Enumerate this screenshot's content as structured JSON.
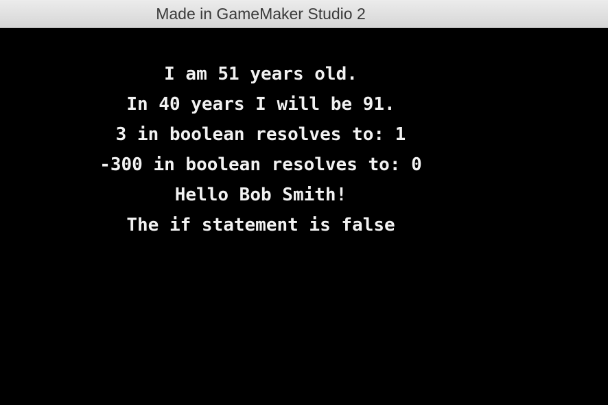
{
  "window": {
    "title": "Made in GameMaker Studio 2"
  },
  "game": {
    "lines": [
      "I am 51 years old.",
      "In 40 years I will be 91.",
      "3 in boolean resolves to: 1",
      "-300 in boolean resolves to: 0",
      "Hello Bob Smith!",
      "The if statement is false"
    ]
  },
  "colors": {
    "background": "#000000",
    "text": "#f2f2f2",
    "titlebar": "#e0e0e0"
  }
}
